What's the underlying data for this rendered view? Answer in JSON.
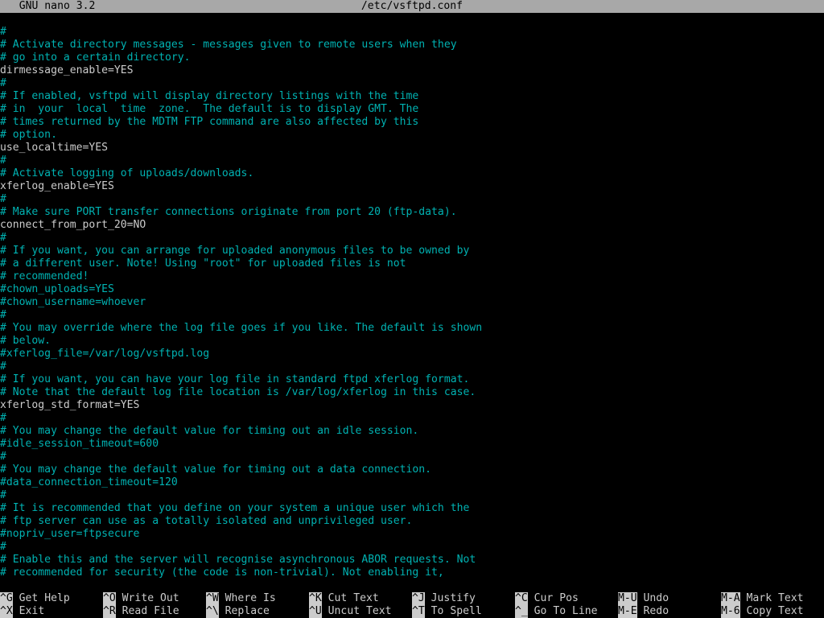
{
  "title": {
    "app": "  GNU nano 3.2",
    "file": "/etc/vsftpd.conf"
  },
  "lines": [
    {
      "t": "comment",
      "text": "#"
    },
    {
      "t": "comment",
      "text": "# Activate directory messages - messages given to remote users when they"
    },
    {
      "t": "comment",
      "text": "# go into a certain directory."
    },
    {
      "t": "setting",
      "text": "dirmessage_enable=YES"
    },
    {
      "t": "comment",
      "text": "#"
    },
    {
      "t": "comment",
      "text": "# If enabled, vsftpd will display directory listings with the time"
    },
    {
      "t": "comment",
      "text": "# in  your  local  time  zone.  The default is to display GMT. The"
    },
    {
      "t": "comment",
      "text": "# times returned by the MDTM FTP command are also affected by this"
    },
    {
      "t": "comment",
      "text": "# option."
    },
    {
      "t": "setting",
      "text": "use_localtime=YES"
    },
    {
      "t": "comment",
      "text": "#"
    },
    {
      "t": "comment",
      "text": "# Activate logging of uploads/downloads."
    },
    {
      "t": "setting",
      "text": "xferlog_enable=YES"
    },
    {
      "t": "comment",
      "text": "#"
    },
    {
      "t": "comment",
      "text": "# Make sure PORT transfer connections originate from port 20 (ftp-data)."
    },
    {
      "t": "setting",
      "text": "connect_from_port_20=NO"
    },
    {
      "t": "comment",
      "text": "#"
    },
    {
      "t": "comment",
      "text": "# If you want, you can arrange for uploaded anonymous files to be owned by"
    },
    {
      "t": "comment",
      "text": "# a different user. Note! Using \"root\" for uploaded files is not"
    },
    {
      "t": "comment",
      "text": "# recommended!"
    },
    {
      "t": "comment",
      "text": "#chown_uploads=YES"
    },
    {
      "t": "comment",
      "text": "#chown_username=whoever"
    },
    {
      "t": "comment",
      "text": "#"
    },
    {
      "t": "comment",
      "text": "# You may override where the log file goes if you like. The default is shown"
    },
    {
      "t": "comment",
      "text": "# below."
    },
    {
      "t": "comment",
      "text": "#xferlog_file=/var/log/vsftpd.log"
    },
    {
      "t": "comment",
      "text": "#"
    },
    {
      "t": "comment",
      "text": "# If you want, you can have your log file in standard ftpd xferlog format."
    },
    {
      "t": "comment",
      "text": "# Note that the default log file location is /var/log/xferlog in this case."
    },
    {
      "t": "setting",
      "text": "xferlog_std_format=YES"
    },
    {
      "t": "comment",
      "text": "#"
    },
    {
      "t": "comment",
      "text": "# You may change the default value for timing out an idle session."
    },
    {
      "t": "comment",
      "text": "#idle_session_timeout=600"
    },
    {
      "t": "comment",
      "text": "#"
    },
    {
      "t": "comment",
      "text": "# You may change the default value for timing out a data connection."
    },
    {
      "t": "comment",
      "text": "#data_connection_timeout=120"
    },
    {
      "t": "comment",
      "text": "#"
    },
    {
      "t": "comment",
      "text": "# It is recommended that you define on your system a unique user which the"
    },
    {
      "t": "comment",
      "text": "# ftp server can use as a totally isolated and unprivileged user."
    },
    {
      "t": "comment",
      "text": "#nopriv_user=ftpsecure"
    },
    {
      "t": "comment",
      "text": "#"
    },
    {
      "t": "comment",
      "text": "# Enable this and the server will recognise asynchronous ABOR requests. Not"
    },
    {
      "t": "comment",
      "text": "# recommended for security (the code is non-trivial). Not enabling it,"
    }
  ],
  "shortcuts": {
    "row1": [
      {
        "key": "^G",
        "label": "Get Help"
      },
      {
        "key": "^O",
        "label": "Write Out"
      },
      {
        "key": "^W",
        "label": "Where Is"
      },
      {
        "key": "^K",
        "label": "Cut Text"
      },
      {
        "key": "^J",
        "label": "Justify"
      },
      {
        "key": "^C",
        "label": "Cur Pos"
      },
      {
        "key": "M-U",
        "label": "Undo"
      },
      {
        "key": "M-A",
        "label": "Mark Text"
      }
    ],
    "row2": [
      {
        "key": "^X",
        "label": "Exit"
      },
      {
        "key": "^R",
        "label": "Read File"
      },
      {
        "key": "^\\",
        "label": "Replace"
      },
      {
        "key": "^U",
        "label": "Uncut Text"
      },
      {
        "key": "^T",
        "label": "To Spell"
      },
      {
        "key": "^_",
        "label": "Go To Line"
      },
      {
        "key": "M-E",
        "label": "Redo"
      },
      {
        "key": "M-6",
        "label": "Copy Text"
      }
    ]
  }
}
